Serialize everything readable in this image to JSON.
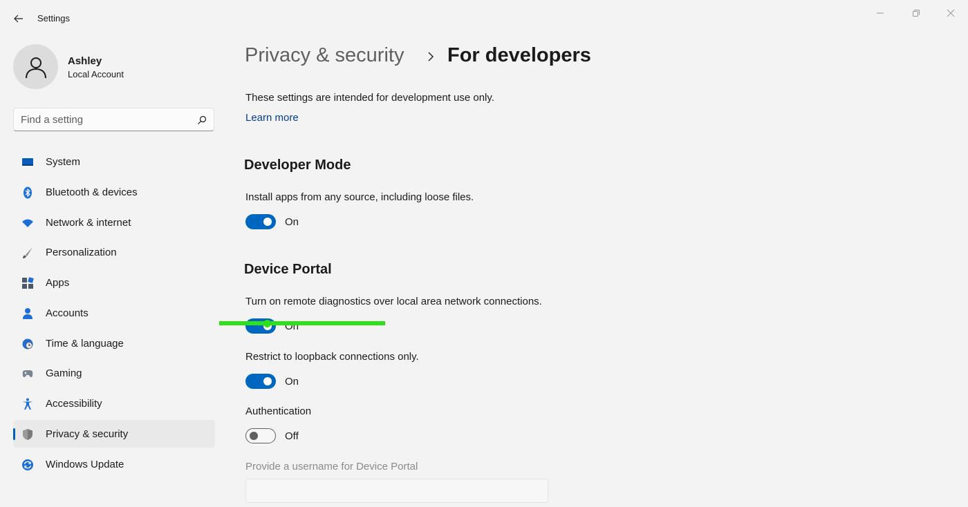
{
  "window": {
    "title": "Settings"
  },
  "profile": {
    "name": "Ashley",
    "account_type": "Local Account"
  },
  "search": {
    "placeholder": "Find a setting"
  },
  "sidebar": {
    "items": [
      {
        "label": "System",
        "icon": "system-icon",
        "selected": false
      },
      {
        "label": "Bluetooth & devices",
        "icon": "bluetooth-icon",
        "selected": false
      },
      {
        "label": "Network & internet",
        "icon": "wifi-icon",
        "selected": false
      },
      {
        "label": "Personalization",
        "icon": "brush-icon",
        "selected": false
      },
      {
        "label": "Apps",
        "icon": "apps-icon",
        "selected": false
      },
      {
        "label": "Accounts",
        "icon": "person-icon",
        "selected": false
      },
      {
        "label": "Time & language",
        "icon": "globe-clock-icon",
        "selected": false
      },
      {
        "label": "Gaming",
        "icon": "gamepad-icon",
        "selected": false
      },
      {
        "label": "Accessibility",
        "icon": "accessibility-icon",
        "selected": false
      },
      {
        "label": "Privacy & security",
        "icon": "shield-icon",
        "selected": true
      },
      {
        "label": "Windows Update",
        "icon": "update-icon",
        "selected": false
      }
    ]
  },
  "header": {
    "breadcrumb_parent": "Privacy & security",
    "title": "For developers"
  },
  "main": {
    "intro": "These settings are intended for development use only.",
    "learn_more": "Learn more",
    "developer_mode": {
      "heading": "Developer Mode",
      "description": "Install apps from any source, including loose files.",
      "toggle_label": "On",
      "toggle_on": true
    },
    "device_portal": {
      "heading": "Device Portal",
      "description": "Turn on remote diagnostics over local area network connections.",
      "toggle_label": "On",
      "toggle_on": true,
      "loopback": {
        "description": "Restrict to loopback connections only.",
        "toggle_label": "On",
        "toggle_on": true
      },
      "authentication": {
        "description": "Authentication",
        "toggle_label": "Off",
        "toggle_on": false
      },
      "username": {
        "label": "Provide a username for Device Portal",
        "value": ""
      }
    }
  },
  "colors": {
    "accent": "#0067c0",
    "selection_indicator": "#005fb8",
    "highlight_mark": "#2ee01a"
  }
}
